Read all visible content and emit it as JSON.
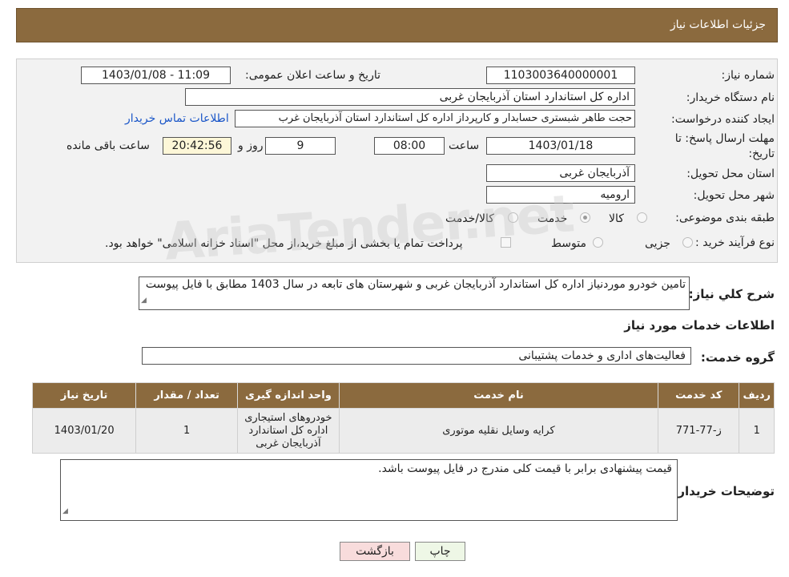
{
  "header": {
    "title": "جزئیات اطلاعات نیاز"
  },
  "fields": {
    "need_number_label": "شماره نیاز:",
    "need_number": "1103003640000001",
    "announce_label": "تاریخ و ساعت اعلان عمومی:",
    "announce_value": "1403/01/08 - 11:09",
    "buyer_org_label": "نام دستگاه خریدار:",
    "buyer_org": "اداره کل استاندارد استان آذربایجان غربی",
    "creator_label": "ایجاد کننده درخواست:",
    "creator": "حجت طاهر شبستری حسابدار و کارپرداز اداره کل استاندارد استان آذربایجان غرب",
    "contact_link": "اطلاعات تماس خریدار",
    "deadline_label": "مهلت ارسال پاسخ: تا تاریخ:",
    "deadline_date": "1403/01/18",
    "hour_label": "ساعت",
    "deadline_time": "08:00",
    "days_value": "9",
    "days_label": "روز و",
    "remaining_time": "20:42:56",
    "remaining_label": "ساعت باقی مانده",
    "province_label": "استان محل تحویل:",
    "province": "آذربایجان غربی",
    "city_label": "شهر محل تحویل:",
    "city": "ارومیه",
    "category_label": "طبقه بندی موضوعی:",
    "category_options": [
      "کالا",
      "خدمت",
      "کالا/خدمت"
    ],
    "category_selected": "خدمت",
    "process_label": "نوع فرآیند خرید :",
    "process_options": [
      "جزیی",
      "متوسط"
    ],
    "payment_note": "پرداخت تمام یا بخشی از مبلغ خرید،از محل \"اسناد خزانه اسلامی\" خواهد بود."
  },
  "summary": {
    "label": "شرح كلي نياز:",
    "text": "تامین خودرو موردنیاز اداره کل استاندارد آذربایجان غربی و شهرستان های تابعه در سال 1403 مطابق با فایل پیوست"
  },
  "services": {
    "section_title": "اطلاعات خدمات مورد نیاز",
    "group_label": "گروه خدمت:",
    "group_value": "فعالیت‌های اداری و خدمات پشتیبانی"
  },
  "table": {
    "headers": [
      "ردیف",
      "کد خدمت",
      "نام خدمت",
      "واحد اندازه گیری",
      "تعداد / مقدار",
      "تاریخ نیاز"
    ],
    "rows": [
      [
        "1",
        "ز-77-771",
        "کرایه وسایل نقلیه موتوری",
        "خودروهای استیجاری اداره کل استاندارد آذربایجان غربی",
        "1",
        "1403/01/20"
      ]
    ]
  },
  "buyer_notes": {
    "label": "توضیحات خریدار:",
    "text": "قیمت پیشنهادی برابر با قیمت کلی مندرج در فایل پیوست باشد."
  },
  "buttons": {
    "print": "چاپ",
    "back": "بازگشت"
  },
  "watermark": "AriaTender.net",
  "colors": {
    "header_bg": "#8b6a3e",
    "panel_bg": "#f2f2f2",
    "link": "#1a56c8",
    "back_btn_bg": "#f8dcdc",
    "print_btn_bg": "#eef7e6"
  }
}
